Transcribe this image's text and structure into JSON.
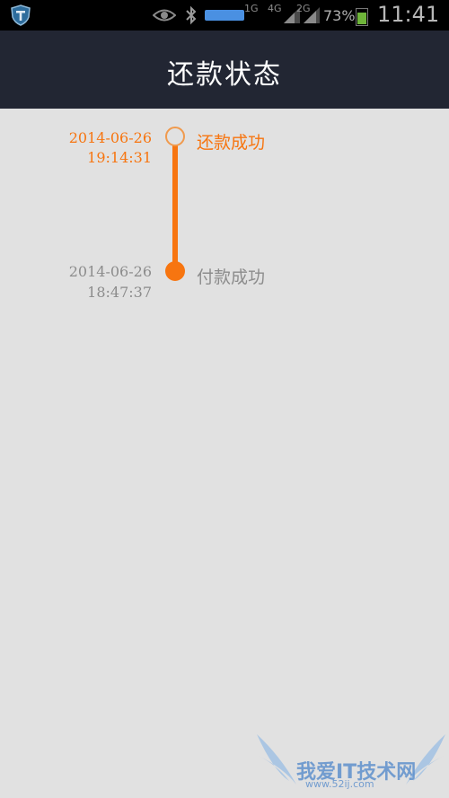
{
  "status_bar": {
    "net_1g": "1G",
    "net_4g": "4G",
    "net_2g": "2G",
    "battery_percent": "73%",
    "clock": "11:41",
    "icons": [
      "app-shield-icon",
      "eye-icon",
      "bluetooth-icon",
      "notification-icon",
      "signal-icon",
      "signal-icon",
      "battery-icon"
    ]
  },
  "header": {
    "title": "还款状态"
  },
  "timeline": {
    "events": [
      {
        "date": "2014-06-26",
        "time": "19:14:31",
        "status": "还款成功",
        "state": "current"
      },
      {
        "date": "2014-06-26",
        "time": "18:47:37",
        "status": "付款成功",
        "state": "done"
      }
    ]
  },
  "watermark": {
    "text": "我爱IT技术网",
    "url": "www.52ij.com"
  },
  "colors": {
    "accent": "#f77510",
    "header_bg": "#222633",
    "page_bg": "#e1e1e1",
    "inactive_text": "#8c8c8c"
  }
}
